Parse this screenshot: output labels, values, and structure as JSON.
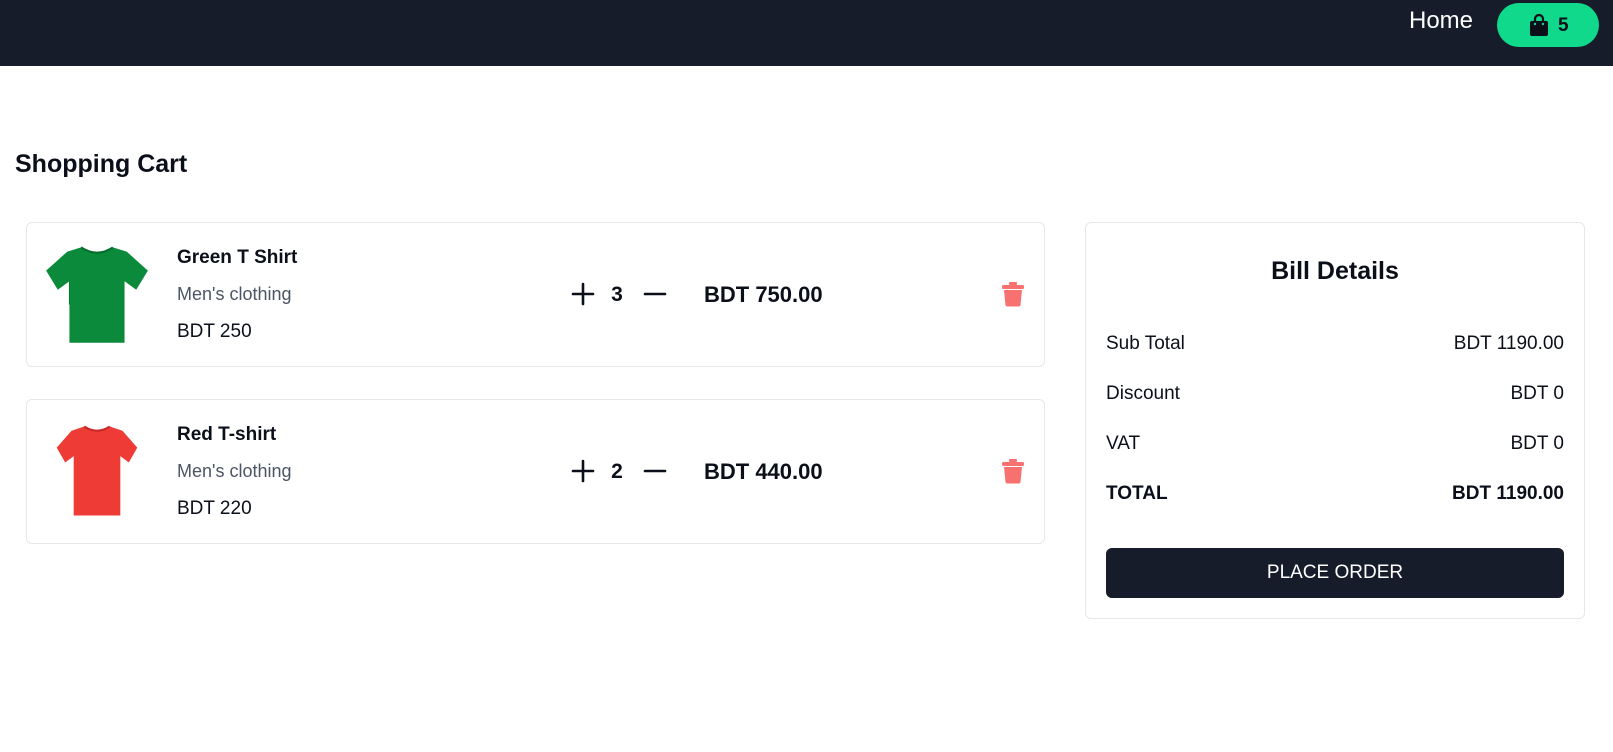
{
  "nav": {
    "home_label": "Home",
    "cart_count": "5",
    "bar_color": "#171c2b",
    "cart_pill_color": "#10d98b",
    "cart_icon": "shopping-bag-icon"
  },
  "page": {
    "title": "Shopping Cart"
  },
  "cart": {
    "items": [
      {
        "name": "Green T Shirt",
        "category": "Men's clothing",
        "unit_price": "BDT 250",
        "quantity": "3",
        "line_total": "BDT 750.00",
        "image_icon": "green-tshirt-image",
        "image_color": "#0a8a3a"
      },
      {
        "name": "Red T-shirt",
        "category": "Men's clothing",
        "unit_price": "BDT 220",
        "quantity": "2",
        "line_total": "BDT 440.00",
        "image_icon": "red-tshirt-image",
        "image_color": "#ef3b36"
      }
    ],
    "increment_icon": "plus-icon",
    "decrement_icon": "minus-icon",
    "remove_icon": "trash-icon",
    "remove_color": "#f87171"
  },
  "bill": {
    "title": "Bill Details",
    "sub_total_label": "Sub Total",
    "sub_total_value": "BDT 1190.00",
    "discount_label": "Discount",
    "discount_value": "BDT 0",
    "vat_label": "VAT",
    "vat_value": "BDT 0",
    "total_label": "TOTAL",
    "total_value": "BDT 1190.00",
    "place_order_label": "PLACE ORDER"
  }
}
